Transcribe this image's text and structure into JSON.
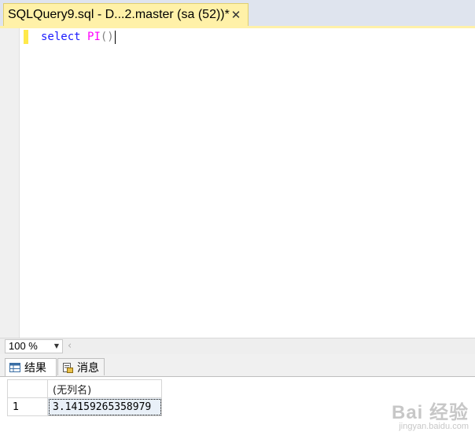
{
  "document_tab": {
    "title": "SQLQuery9.sql - D...2.master (sa (52))*",
    "close_glyph": "✕"
  },
  "editor": {
    "keyword": "select",
    "function_name": "PI",
    "parens": "()"
  },
  "zoom": {
    "value": "100 %"
  },
  "result_tabs": [
    {
      "label": "结果",
      "icon": "grid-icon",
      "active": true
    },
    {
      "label": "消息",
      "icon": "messages-icon",
      "active": false
    }
  ],
  "results_grid": {
    "columns": [
      "(无列名)"
    ],
    "rows": [
      {
        "row_number": "1",
        "values": [
          "3.14159265358979"
        ]
      }
    ]
  },
  "watermark": {
    "brand": "Bai 经验",
    "sub": "jingyan.baidu.com"
  },
  "colors": {
    "tab_yellow": "#fff1a8",
    "keyword_blue": "#1a1aff",
    "function_magenta": "#ff00ff",
    "change_marker": "#ffe94a"
  }
}
